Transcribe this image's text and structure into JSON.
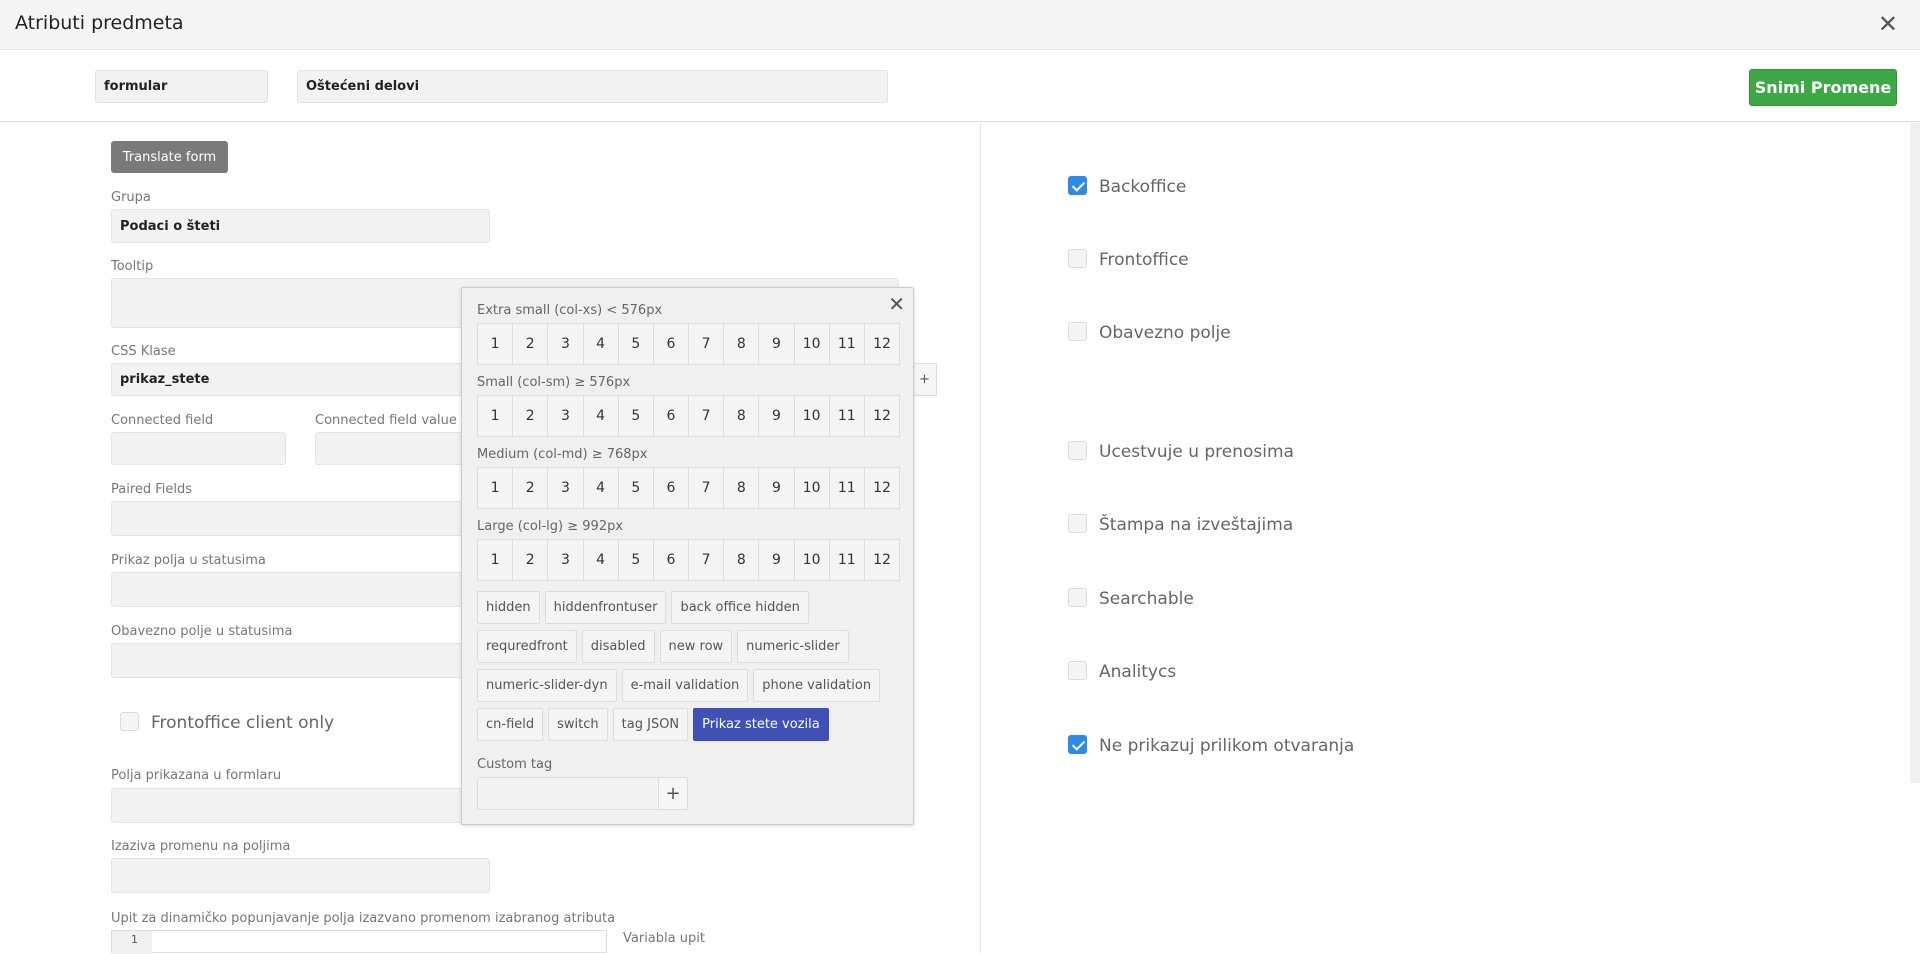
{
  "window": {
    "title": "Atributi predmeta",
    "close_label": "✕"
  },
  "toolbar": {
    "name_value": "formular",
    "label_value": "Oštećeni delovi",
    "save_label": "Snimi Promene"
  },
  "form": {
    "translate_label": "Translate form",
    "grupa_label": "Grupa",
    "grupa_value": "Podaci o šteti",
    "tooltip_label": "Tooltip",
    "css_label": "CSS Klase",
    "css_value": "prikaz_stete",
    "css_add": "+",
    "connected_field_label": "Connected field",
    "connected_value_label": "Connected field value",
    "paired_label": "Paired Fields",
    "status_label": "Prikaz polja u statusima",
    "required_status_label": "Obavezno polje u statusima",
    "frontoffice_client_label": "Frontoffice client only",
    "shown_fields_label": "Polja prikazana u formlaru",
    "changes_label": "Izaziva promenu na poljima",
    "query_label": "Upit za dinamičko popunjavanje polja izazvano promenom izabranog atributa",
    "query_var_label": "Variabla upit",
    "code_line": "1"
  },
  "popup": {
    "close_label": "✕",
    "sections": [
      {
        "label": "Extra small (col-xs) < 576px"
      },
      {
        "label": "Small (col-sm) ≥ 576px"
      },
      {
        "label": "Medium (col-md) ≥ 768px"
      },
      {
        "label": "Large (col-lg) ≥ 992px"
      }
    ],
    "columns": [
      "1",
      "2",
      "3",
      "4",
      "5",
      "6",
      "7",
      "8",
      "9",
      "10",
      "11",
      "12"
    ],
    "tag_rows": [
      [
        "hidden",
        "hiddenfrontuser",
        "back office hidden"
      ],
      [
        "requredfront",
        "disabled",
        "new row",
        "numeric-slider"
      ],
      [
        "numeric-slider-dyn",
        "e-mail validation",
        "phone validation"
      ],
      [
        "cn-field",
        "switch",
        "tag JSON",
        "Prikaz stete vozila"
      ]
    ],
    "active_tag": "Prikaz stete vozila",
    "custom_tag_label": "Custom tag",
    "custom_add": "+"
  },
  "options": {
    "backoffice": "Backoffice",
    "frontoffice": "Frontoffice",
    "obavezno": "Obavezno polje",
    "ucestvuje": "Ucestvuje u prenosima",
    "stampa": "Štampa na izveštajima",
    "searchable": "Searchable",
    "analitycs": "Analitycs",
    "ne_prikazuj": "Ne prikazuj prilikom otvaranja"
  },
  "colors": {
    "accent_green": "#3fa846",
    "active_tag": "#3f51b5",
    "checkbox": "#2d8ae6"
  }
}
